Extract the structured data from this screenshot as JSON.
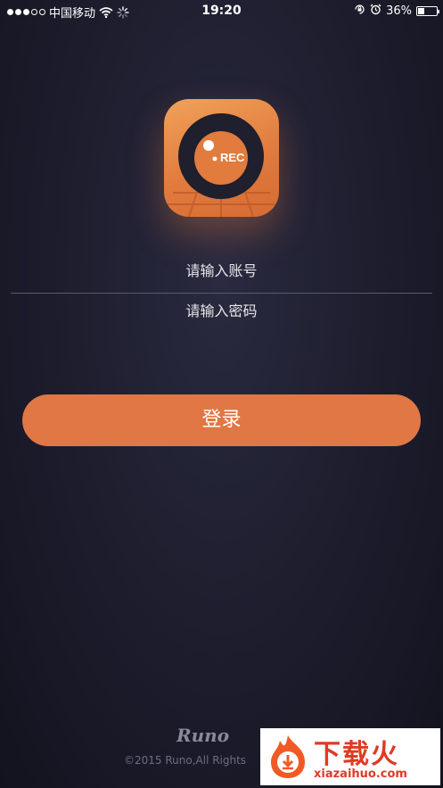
{
  "status_bar": {
    "signal_filled": 3,
    "signal_total": 5,
    "carrier": "中国移动",
    "time": "19:20",
    "battery_percent": "36%",
    "battery_level": 0.36
  },
  "logo": {
    "badge_text": "REC",
    "icon": "record-camera-icon",
    "colors": {
      "primary": "#e17b3e",
      "dark": "#1f1f2e"
    }
  },
  "login_form": {
    "account_placeholder": "请输入账号",
    "password_placeholder": "请输入密码",
    "submit_label": "登录"
  },
  "footer": {
    "brand": "Runo",
    "copyright": "©2015 Runo,All Rights"
  },
  "watermark": {
    "title": "下载火",
    "url": "xiazaihuo.com"
  },
  "colors": {
    "accent": "#e07744",
    "background": "#1c1c2c"
  }
}
